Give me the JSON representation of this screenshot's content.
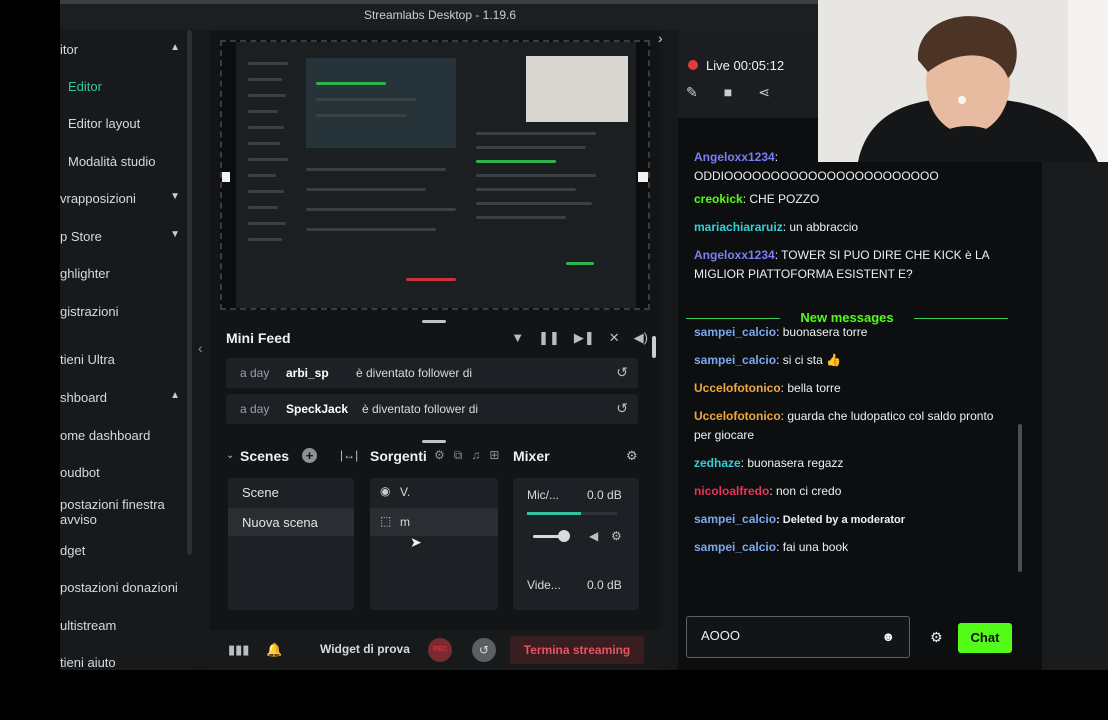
{
  "window": {
    "title": "Streamlabs Desktop - 1.19.6"
  },
  "sidebar": {
    "items": [
      {
        "label": "itor",
        "chevron": "▲"
      },
      {
        "label": "Editor",
        "active": true,
        "sub": true
      },
      {
        "label": "Editor layout",
        "sub": true
      },
      {
        "label": "Modalità studio",
        "sub": true
      },
      {
        "label": "vrapposizioni",
        "chevron": "▼"
      },
      {
        "label": "p Store",
        "chevron": "▼"
      },
      {
        "label": "ghlighter"
      },
      {
        "label": "gistrazioni"
      },
      {
        "label": "tieni Ultra"
      },
      {
        "label": "shboard",
        "chevron": "▲"
      },
      {
        "label": "ome dashboard"
      },
      {
        "label": "oudbot"
      },
      {
        "label": "postazioni finestra avviso"
      },
      {
        "label": "dget"
      },
      {
        "label": "postazioni donazioni"
      },
      {
        "label": "ultistream"
      },
      {
        "label": "tieni aiuto"
      }
    ]
  },
  "mini_feed": {
    "title": "Mini Feed",
    "icons": [
      "filter-icon",
      "pause-icon",
      "skip-icon",
      "mute-alerts-icon",
      "volume-icon"
    ],
    "rows": [
      {
        "time": "a day",
        "user": "arbi_sp",
        "action": "è diventato follower di"
      },
      {
        "time": "a day",
        "user": "SpeckJack",
        "action": "è diventato follower di"
      }
    ]
  },
  "scenes": {
    "title": "Scenes",
    "items": [
      {
        "label": "Scene",
        "selected": false
      },
      {
        "label": "Nuova scena",
        "selected": true
      }
    ]
  },
  "sources": {
    "title": "Sorgenti",
    "items": [
      {
        "label": "V.",
        "icon": "webcam-icon",
        "selected": false
      },
      {
        "label": "m",
        "icon": "selection-icon",
        "selected": true
      }
    ]
  },
  "mixer": {
    "title": "Mixer",
    "channels": [
      {
        "label": "Mic/...",
        "value": "0.0 dB"
      },
      {
        "label": "Vide...",
        "value": "0.0 dB"
      }
    ]
  },
  "footer": {
    "widget_label": "Widget di prova",
    "rec_label": "REC",
    "end_stream_label": "Termina streaming"
  },
  "chat": {
    "live_label": "Live",
    "live_time": "00:05:12",
    "messages_before": [
      {
        "user": "Angeloxx1234",
        "color": "#7b7ff7",
        "text": ": ODDIOOOOOOOOOOOOOOOOOOOOOOO"
      },
      {
        "user": "creokick",
        "color": "#53fc18",
        "text": ": CHE POZZO"
      },
      {
        "user": "mariachiararuiz",
        "color": "#35d0d6",
        "text": ": un abbraccio"
      },
      {
        "user": "Angeloxx1234",
        "color": "#7b7ff7",
        "text": ": TOWER SI PUO DIRE CHE KICK è LA MIGLIOR PIATTOFORMA ESISTENT E?"
      }
    ],
    "new_messages_label": "New messages",
    "messages_after": [
      {
        "user": "sampei_calcio",
        "color": "#7aa8f0",
        "text": ": buonasera torre"
      },
      {
        "user": "sampei_calcio",
        "color": "#7aa8f0",
        "text": ": si ci sta 👍"
      },
      {
        "user": "Uccelofotonico",
        "color": "#f0a83c",
        "text": ": bella torre"
      },
      {
        "user": "Uccelofotonico",
        "color": "#f0a83c",
        "text": ": guarda che ludopatico col saldo pronto per giocare"
      },
      {
        "user": "zedhaze",
        "color": "#35d0d6",
        "text": ": buonasera regazz"
      },
      {
        "user": "nicoloalfredo",
        "color": "#e8345a",
        "text": ": non ci credo"
      },
      {
        "user": "sampei_calcio",
        "color": "#7aa8f0",
        "text": ": Deleted by a moderator"
      },
      {
        "user": "sampei_calcio",
        "color": "#7aa8f0",
        "text": ": fai una book"
      }
    ],
    "input_value": "AOOO",
    "send_label": "Chat"
  },
  "colors": {
    "accent_teal": "#31c3a2",
    "kick_green": "#53fc18",
    "end_stream_red": "#e8545e",
    "live_red": "#e33b3b"
  }
}
